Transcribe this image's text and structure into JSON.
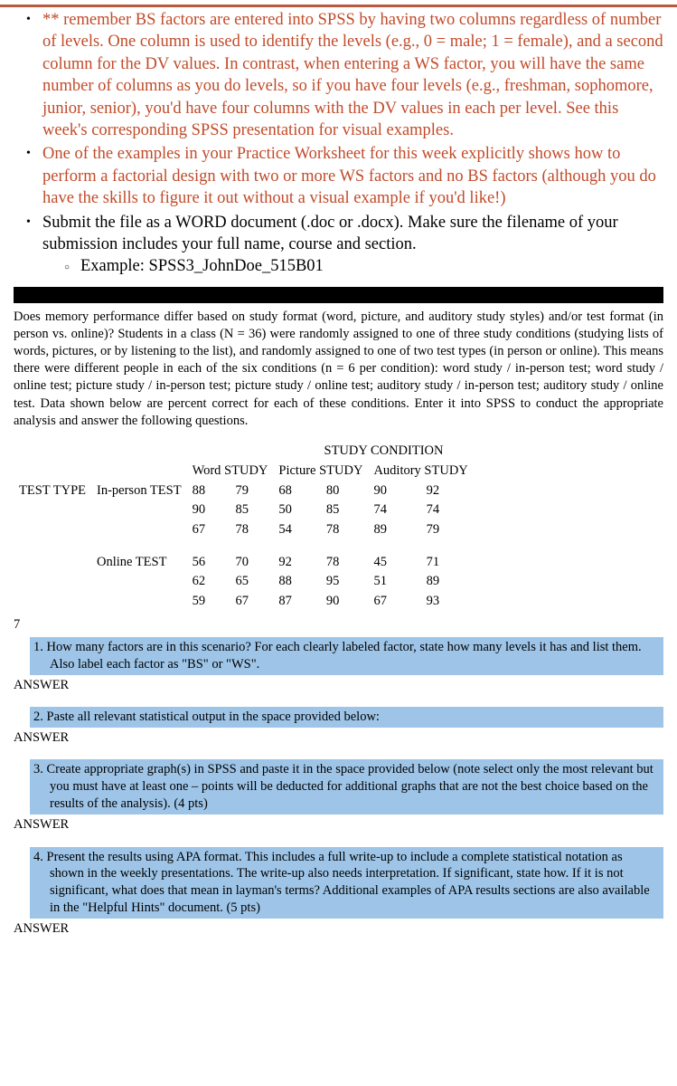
{
  "bullets": {
    "b1": "** remember BS factors are entered into SPSS by having two columns regardless of number of levels. One column is used to identify the levels (e.g., 0 = male; 1 = female), and a second column for the DV values. In contrast, when entering a WS factor, you will have the same number of columns as you do levels, so if you have four levels (e.g., freshman, sophomore, junior, senior), you'd have four columns with the DV values in each per level. See this week's corresponding SPSS presentation for visual examples.",
    "b2": "One of the examples in your Practice Worksheet for this week explicitly shows how to perform a factorial design with two or more WS factors and no BS factors (although you do have the skills to figure it out without a visual example if you'd like!)",
    "b3": "Submit the file as a WORD document (.doc or .docx). Make sure the filename of your submission includes your full name, course and section.",
    "sub1_prefix": "Example:  ",
    "sub1_value": "SPSS3_JohnDoe_515B01"
  },
  "prompt": "Does memory performance differ based on study format (word, picture, and auditory study styles) and/or test format (in person vs. online)? Students in a class (N = 36) were randomly assigned to one of three study conditions (studying lists of words, pictures, or by listening to the list), and randomly assigned to one of two test types (in person or online). This means there were different people in each of the six conditions (n = 6 per condition): word study / in-person test; word study / online test; picture study / in-person test; picture study / online test; auditory study / in-person test; auditory study / online test. Data shown below are percent correct for each of these conditions. Enter it into SPSS to conduct the appropriate analysis and answer the following questions.",
  "table": {
    "title": "STUDY CONDITION",
    "col_labels": [
      "Word STUDY",
      "Picture STUDY",
      "Auditory STUDY"
    ],
    "row_group_label": "TEST TYPE",
    "rows": {
      "inperson_label": "In-person TEST",
      "online_label": "Online TEST",
      "inperson": [
        [
          "88",
          "79",
          "68",
          "80",
          "90",
          "92"
        ],
        [
          "90",
          "85",
          "50",
          "85",
          "74",
          "74"
        ],
        [
          "67",
          "78",
          "54",
          "78",
          "89",
          "79"
        ]
      ],
      "online": [
        [
          "56",
          "70",
          "92",
          "78",
          "45",
          "71"
        ],
        [
          "62",
          "65",
          "88",
          "95",
          "51",
          "89"
        ],
        [
          "59",
          "67",
          "87",
          "90",
          "67",
          "93"
        ]
      ]
    }
  },
  "seven": "7",
  "questions": {
    "q1": "1. How many factors are in this scenario? For each clearly labeled factor, state how many levels it has and list them. Also label each factor as \"BS\" or \"WS\".",
    "q2": "2. Paste all relevant statistical output in the space provided below:",
    "q3": "3. Create appropriate graph(s) in SPSS and paste it in the space provided below (note select only the most relevant but you must have at least one – points will be deducted for additional graphs that are not the best choice based on the results of the analysis). (4 pts)",
    "q4": "4. Present the results using APA format. This includes a full write-up to include a complete statistical notation as shown in the weekly presentations. The write-up also needs interpretation. If significant, state how. If it is not significant, what does that mean in layman's terms? Additional examples of APA results sections are also available in the \"Helpful Hints\" document. (5 pts)"
  },
  "answer_label": "ANSWER",
  "chart_data": {
    "type": "table",
    "title": "STUDY CONDITION",
    "row_factor": "TEST TYPE",
    "col_factor": "STUDY CONDITION",
    "columns": [
      "Word STUDY",
      "Word STUDY",
      "Picture STUDY",
      "Picture STUDY",
      "Auditory STUDY",
      "Auditory STUDY"
    ],
    "groups": [
      {
        "label": "In-person TEST",
        "values": [
          [
            88,
            79,
            68,
            80,
            90,
            92
          ],
          [
            90,
            85,
            50,
            85,
            74,
            74
          ],
          [
            67,
            78,
            54,
            78,
            89,
            79
          ]
        ]
      },
      {
        "label": "Online TEST",
        "values": [
          [
            56,
            70,
            92,
            78,
            45,
            71
          ],
          [
            62,
            65,
            88,
            95,
            51,
            89
          ],
          [
            59,
            67,
            87,
            90,
            67,
            93
          ]
        ]
      }
    ]
  }
}
